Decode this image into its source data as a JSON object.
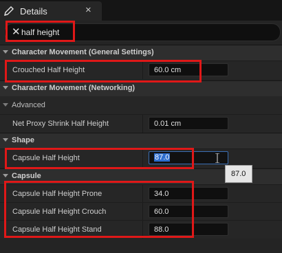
{
  "tab": {
    "title": "Details",
    "close_glyph": "×",
    "icon": "pencil-icon"
  },
  "search": {
    "value": "half height",
    "clear_glyph": "✕",
    "clear_icon": "close-icon"
  },
  "categories": {
    "general": "Character Movement (General Settings)",
    "networking": "Character Movement (Networking)",
    "shape": "Shape",
    "capsule": "Capsule"
  },
  "advanced_label": "Advanced",
  "properties": {
    "crouched_half_height": {
      "label": "Crouched Half Height",
      "value": "60.0 cm"
    },
    "net_proxy_shrink": {
      "label": "Net Proxy Shrink Half Height",
      "value": "0.01 cm"
    },
    "capsule_half_height": {
      "label": "Capsule Half Height",
      "value": "87.0"
    },
    "capsule_prone": {
      "label": "Capsule Half Height Prone",
      "value": "34.0"
    },
    "capsule_crouch": {
      "label": "Capsule Half Height Crouch",
      "value": "60.0"
    },
    "capsule_stand": {
      "label": "Capsule Half Height Stand",
      "value": "88.0"
    }
  },
  "tooltip": "87.0",
  "colors": {
    "highlight": "#e01818",
    "selection": "#2e6ecf",
    "panel": "#242424"
  }
}
